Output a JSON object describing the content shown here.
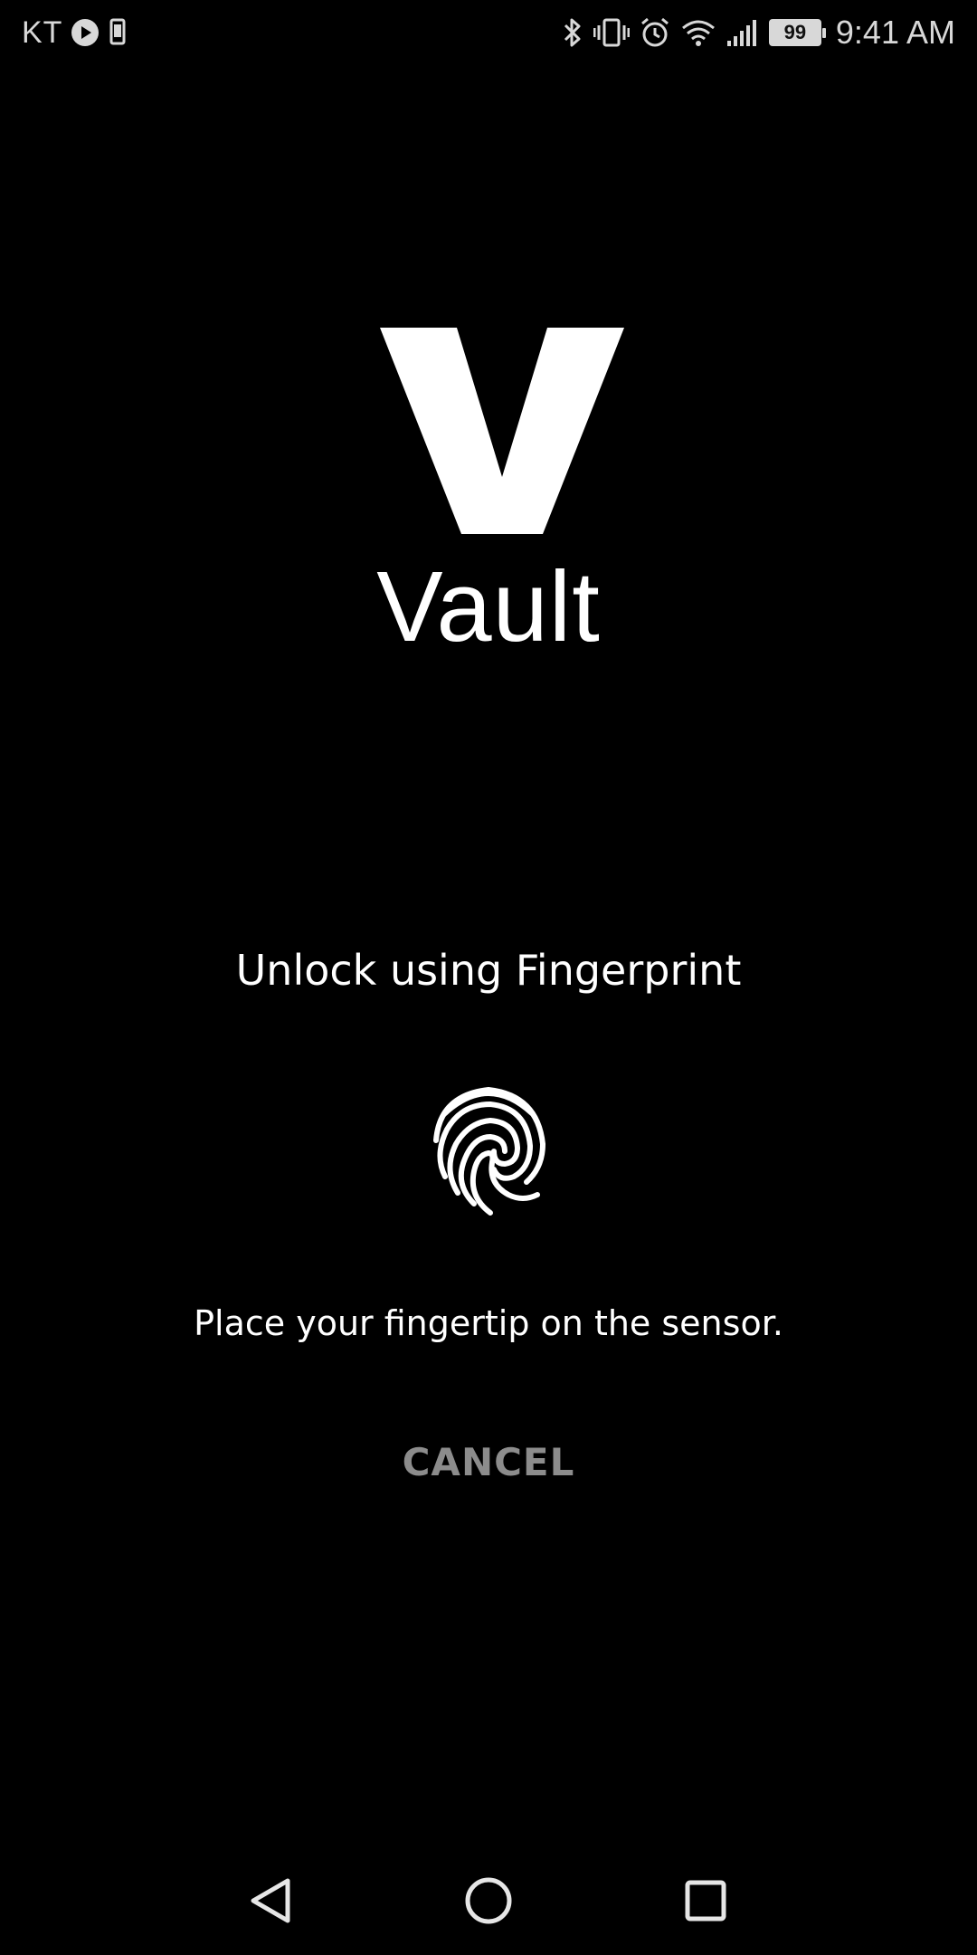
{
  "status_bar": {
    "carrier": "KT",
    "battery_level": "99",
    "time": "9:41 AM",
    "icons": [
      "play-icon",
      "phone-icon",
      "bluetooth-icon",
      "vibrate-icon",
      "alarm-icon",
      "wifi-icon",
      "signal-icon",
      "battery-icon"
    ]
  },
  "app": {
    "name": "Vault",
    "logo_icon": "v-logo-icon"
  },
  "dialog": {
    "title": "Unlock using Fingerprint",
    "fingerprint_icon": "fingerprint-icon",
    "hint": "Place your fingertip on the sensor.",
    "cancel_label": "CANCEL"
  },
  "nav_bar": {
    "buttons": [
      "back-icon",
      "home-icon",
      "recents-icon"
    ]
  },
  "colors": {
    "background": "#000000",
    "text": "#ffffff",
    "cancel": "#8c8c8c",
    "status": "#d8d8d8"
  }
}
